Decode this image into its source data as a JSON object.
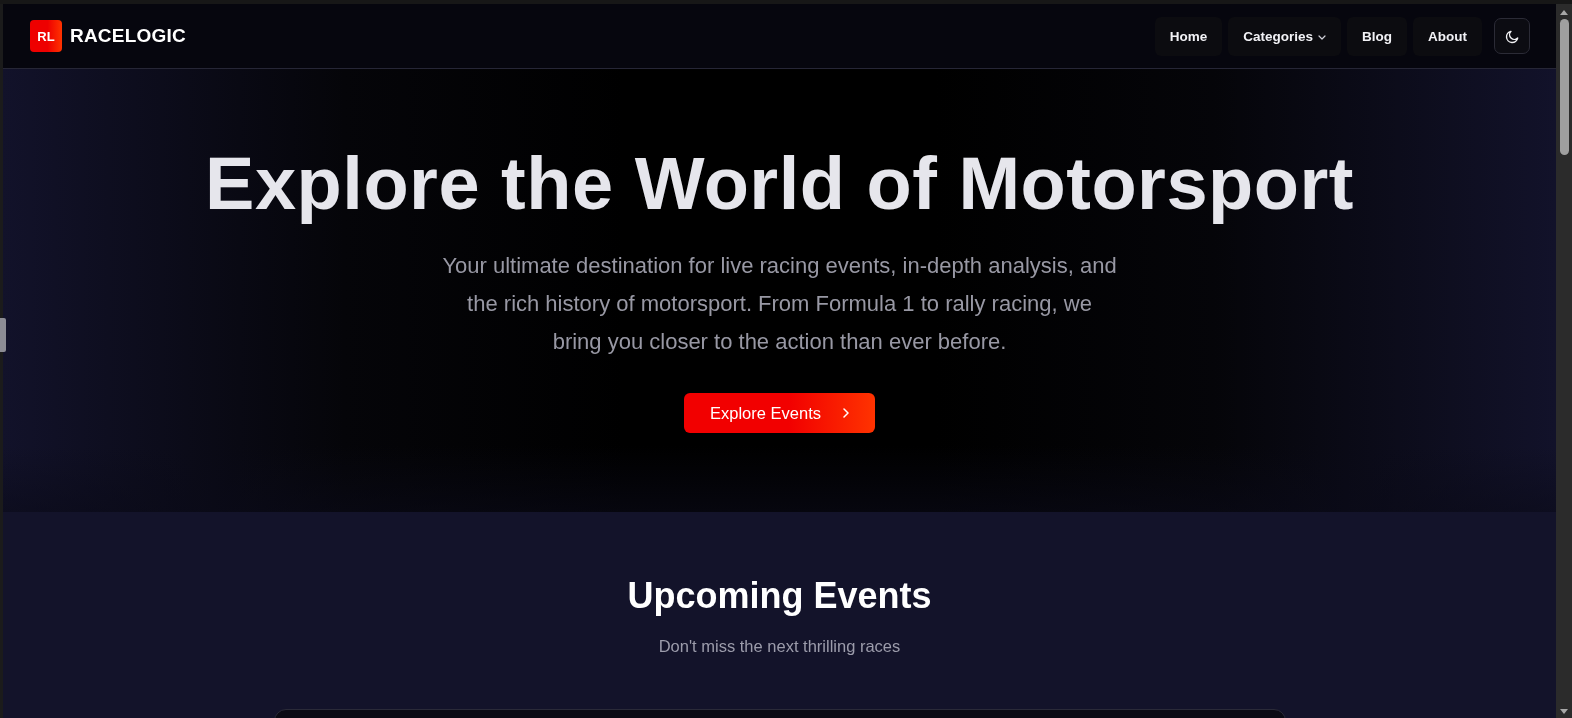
{
  "header": {
    "logo": {
      "mark": "RL",
      "name": "RACELOGIC"
    },
    "nav": [
      {
        "label": "Home",
        "kind": "link"
      },
      {
        "label": "Categories",
        "kind": "dropdown"
      },
      {
        "label": "Blog",
        "kind": "link"
      },
      {
        "label": "About",
        "kind": "link"
      }
    ]
  },
  "hero": {
    "title": "Explore the World of Motorsport",
    "subtitle_lines": [
      "Your ultimate destination for live racing events, in-depth analysis, and",
      "the rich history of motorsport. From Formula 1 to rally racing, we",
      "bring you closer to the action than ever before."
    ],
    "button": "Explore Events"
  },
  "upcoming": {
    "title": "Upcoming Events",
    "subtitle": "Don't miss the next thrilling races"
  }
}
